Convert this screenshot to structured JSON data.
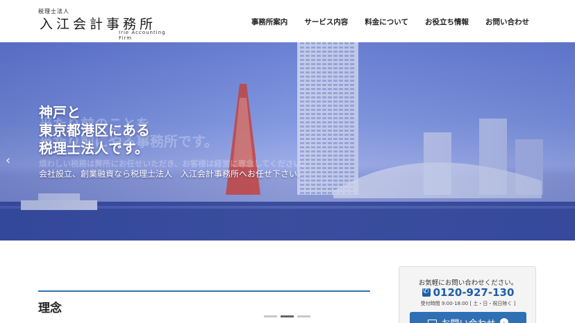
{
  "header": {
    "logo_sub": "税理士法人",
    "logo_main": "入江会計事務所",
    "logo_en": "Irie Accounting Firm",
    "nav": [
      {
        "label": "事務所案内"
      },
      {
        "label": "サービス内容"
      },
      {
        "label": "料金について"
      },
      {
        "label": "お役立ち情報"
      },
      {
        "label": "お問い合わせ"
      }
    ]
  },
  "hero": {
    "lines": [
      "神戸と",
      "東京都港区にある",
      "税理士法人です。"
    ],
    "sub": "会社設立、創業融資なら税理士法人　入江会計事務所へお任せ下さい。",
    "ghost_lines": [
      "当たり前のことを",
      "当たり前にやる事務所です。",
      "煩わしい税務は弊所にお任せいただき、お客様は経営に専念してください。"
    ],
    "prev_icon": "chevron-left-icon"
  },
  "section": {
    "title": "理念"
  },
  "slider": {
    "dots": 3,
    "active": 1
  },
  "contact": {
    "lead": "お気軽にお問い合わせください。",
    "phone": "0120-927-130",
    "hours": "受付時間 9:00-18:00 [ 土・日・祝日除く ]",
    "button_label": "お問い合わせ"
  },
  "colors": {
    "accent": "#2f6fb3",
    "phone": "#1f5ea8"
  }
}
